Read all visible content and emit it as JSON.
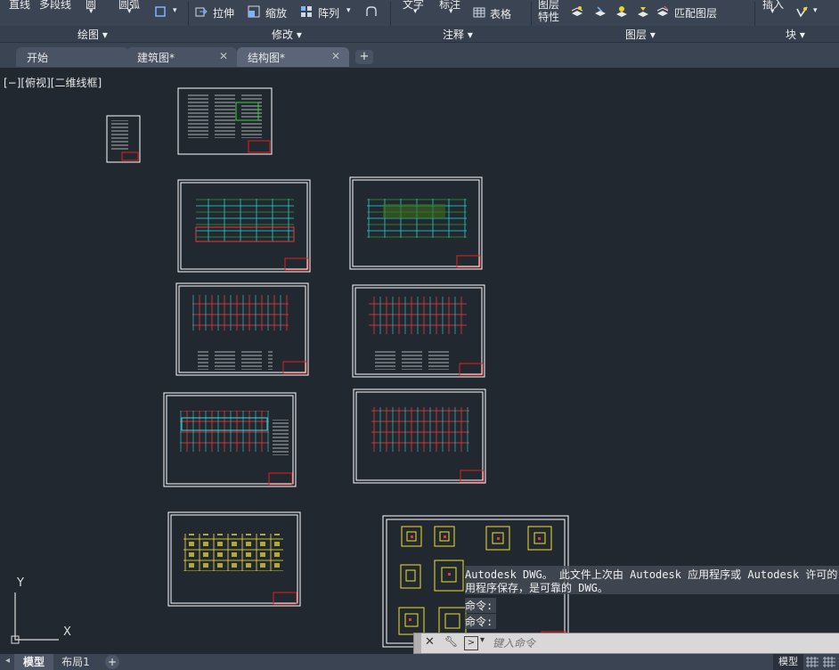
{
  "ribbon": {
    "draw_tools": [
      "直线",
      "多段线",
      "圆",
      "圆弧"
    ],
    "modify_tools": [
      "拉伸",
      "缩放",
      "阵列"
    ],
    "annotate_tools": [
      "文字",
      "标注",
      "表格"
    ],
    "layer_tools": [
      "图层",
      "特性",
      "匹配图层"
    ],
    "block_tools": [
      "插入"
    ],
    "panels": [
      "绘图",
      "修改",
      "注释",
      "图层",
      "块"
    ]
  },
  "tabs": [
    {
      "label": "开始",
      "closable": false,
      "active": false
    },
    {
      "label": "建筑图*",
      "closable": true,
      "active": false
    },
    {
      "label": "结构图*",
      "closable": true,
      "active": true
    }
  ],
  "tab_add": "+",
  "viewport_label": "[−][俯视][二维线框]",
  "ucs": {
    "x_label": "X",
    "y_label": "Y"
  },
  "command": {
    "history": [
      "Autodesk DWG。  此文件上次由 Autodesk 应用程序或 Autodesk 许可的",
      "用程序保存，是可靠的 DWG。",
      "命令:",
      "命令:"
    ],
    "placeholder": "键入命令"
  },
  "layout_tabs": [
    "模型",
    "布局1",
    "+"
  ],
  "status": {
    "model": "模型"
  },
  "colors": {
    "background": "#212830",
    "ribbon": "#3b4453",
    "sheet_border": "#ffffff",
    "title_block": "#e02020"
  }
}
